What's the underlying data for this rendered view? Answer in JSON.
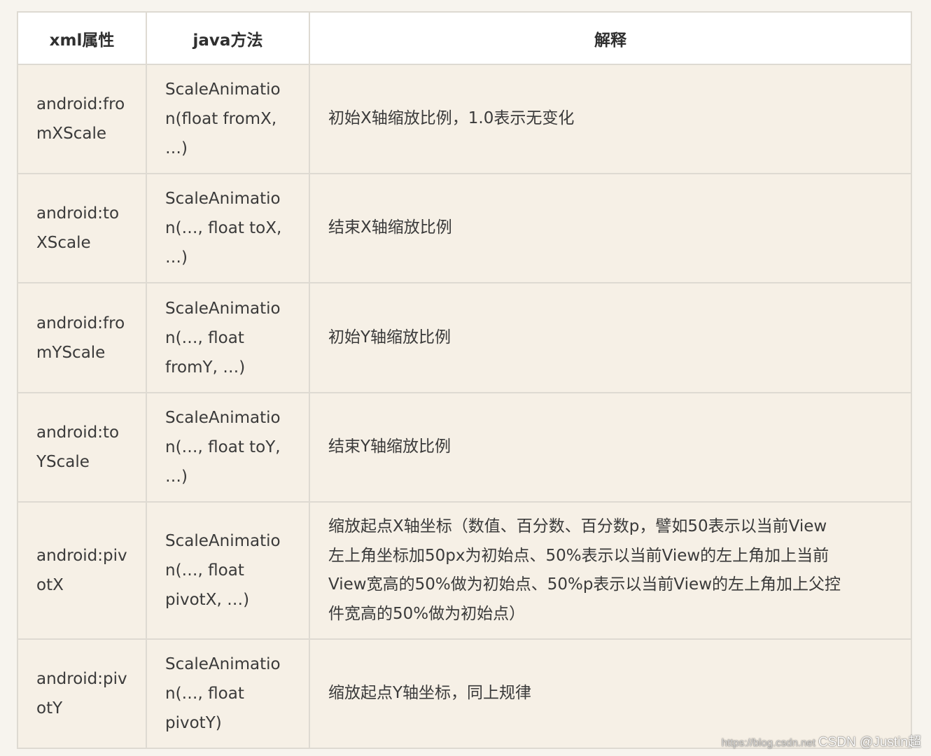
{
  "table": {
    "headers": [
      "xml属性",
      "java方法",
      "解释"
    ],
    "rows": [
      {
        "attr": [
          "android:fro",
          "mXScale"
        ],
        "method": [
          "ScaleAnimatio",
          "n(float fromX,",
          "…)"
        ],
        "desc": [
          "初始X轴缩放比例，1.0表示无变化"
        ]
      },
      {
        "attr": [
          "android:to",
          "XScale"
        ],
        "method": [
          "ScaleAnimatio",
          "n(…, float toX,",
          "…)"
        ],
        "desc": [
          "结束X轴缩放比例"
        ]
      },
      {
        "attr": [
          "android:fro",
          "mYScale"
        ],
        "method": [
          "ScaleAnimatio",
          "n(…, float",
          "fromY, …)"
        ],
        "desc": [
          "初始Y轴缩放比例"
        ]
      },
      {
        "attr": [
          "android:to",
          "YScale"
        ],
        "method": [
          "ScaleAnimatio",
          "n(…, float toY,",
          "…)"
        ],
        "desc": [
          "结束Y轴缩放比例"
        ]
      },
      {
        "attr": [
          "android:piv",
          "otX"
        ],
        "method": [
          "ScaleAnimatio",
          "n(…, float",
          "pivotX, …)"
        ],
        "desc": [
          "缩放起点X轴坐标（数值、百分数、百分数p，譬如50表示以当前View",
          "左上角坐标加50px为初始点、50%表示以当前View的左上角加上当前",
          "View宽高的50%做为初始点、50%p表示以当前View的左上角加上父控",
          "件宽高的50%做为初始点）"
        ]
      },
      {
        "attr": [
          "android:piv",
          "otY"
        ],
        "method": [
          "ScaleAnimatio",
          "n(…, float",
          "pivotY)"
        ],
        "desc": [
          "缩放起点Y轴坐标，同上规律"
        ]
      }
    ]
  },
  "watermark": {
    "url": "https://blog.csdn.net",
    "text": "CSDN @Justin超"
  }
}
